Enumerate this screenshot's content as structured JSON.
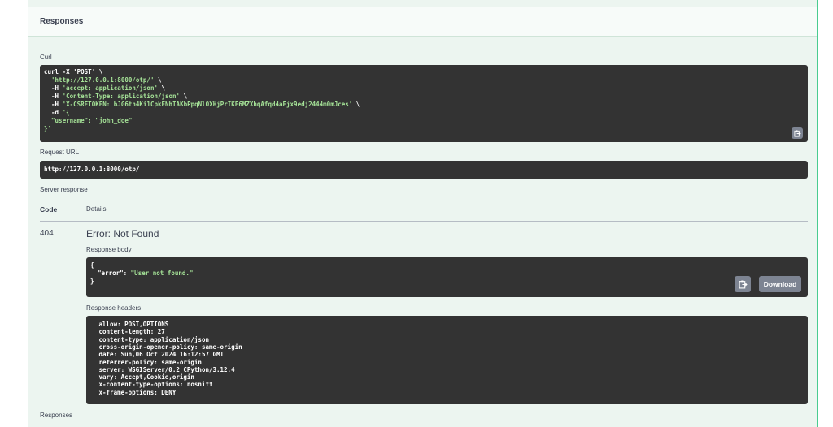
{
  "section": {
    "title": "Responses"
  },
  "curl": {
    "label": "Curl",
    "lines": [
      "curl -X 'POST' \\",
      "  'http://127.0.0.1:8000/otp/' \\",
      "  -H 'accept: application/json' \\",
      "  -H 'Content-Type: application/json' \\",
      "  -H 'X-CSRFTOKEN: bJG6tn4Ki1CpkENhIAKbPpqNlOXHjPrIKF6MZXhqAfqd4aFjx9edj2444m0mJces' \\",
      "  -d '{",
      "  \"username\": \"john_doe\"",
      "}'"
    ]
  },
  "request_url": {
    "label": "Request URL",
    "value": "http://127.0.0.1:8000/otp/"
  },
  "server_response": {
    "label": "Server response",
    "col_code": "Code",
    "col_details": "Details",
    "code": "404",
    "status_text": "Error: Not Found",
    "body_label": "Response body",
    "body_lines": [
      "{",
      "  \"error\": \"User not found.\"",
      "}"
    ],
    "download_label": "Download",
    "headers_label": "Response headers",
    "header_lines": [
      " allow: POST,OPTIONS",
      " content-length: 27",
      " content-type: application/json",
      " cross-origin-opener-policy: same-origin",
      " date: Sun,06 Oct 2024 16:12:57 GMT",
      " referrer-policy: same-origin",
      " server: WSGIServer/0.2 CPython/3.12.4",
      " vary: Accept,Cookie,origin",
      " x-content-type-options: nosniff",
      " x-frame-options: DENY"
    ]
  },
  "footer": {
    "title": "Responses"
  },
  "icons": {
    "copy": "clipboard-copy-icon"
  },
  "colors": {
    "code_bg": "#333333",
    "string": "#a5e297",
    "border_green": "#49cc90",
    "panel_bg": "#ecf5f0"
  }
}
